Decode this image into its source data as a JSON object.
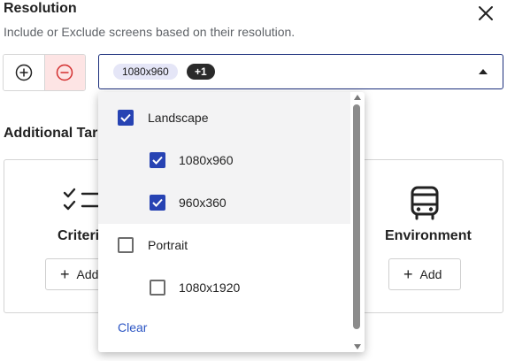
{
  "dialog": {
    "title": "Resolution",
    "subtitle": "Include or Exclude screens based on their resolution.",
    "close_icon": "close-icon"
  },
  "mode": {
    "include_icon": "plus-circle-icon",
    "exclude_icon": "minus-circle-icon",
    "selected": "exclude",
    "exclude_color": "#d32f2f"
  },
  "select": {
    "chip_value": "1080x960",
    "more_badge": "+1",
    "caret_icon": "caret-up-icon",
    "border_color": "#1c2f7c"
  },
  "additional": {
    "label": "Additional Targ",
    "criteria_label": "Criteri",
    "criteria_add": "Add",
    "environment_label": "Environment",
    "environment_add": "Add",
    "environment_icon": "bus-icon",
    "criteria_icon": "checklist-icon"
  },
  "dropdown": {
    "options": [
      {
        "label": "Landscape",
        "checked": true,
        "level": 0
      },
      {
        "label": "1080x960",
        "checked": true,
        "level": 1
      },
      {
        "label": "960x360",
        "checked": true,
        "level": 1
      },
      {
        "label": "Portrait",
        "checked": false,
        "level": 0
      },
      {
        "label": "1080x1920",
        "checked": false,
        "level": 1
      }
    ],
    "clear_label": "Clear",
    "check_color": "#2743b3",
    "link_color": "#2b55c4"
  }
}
